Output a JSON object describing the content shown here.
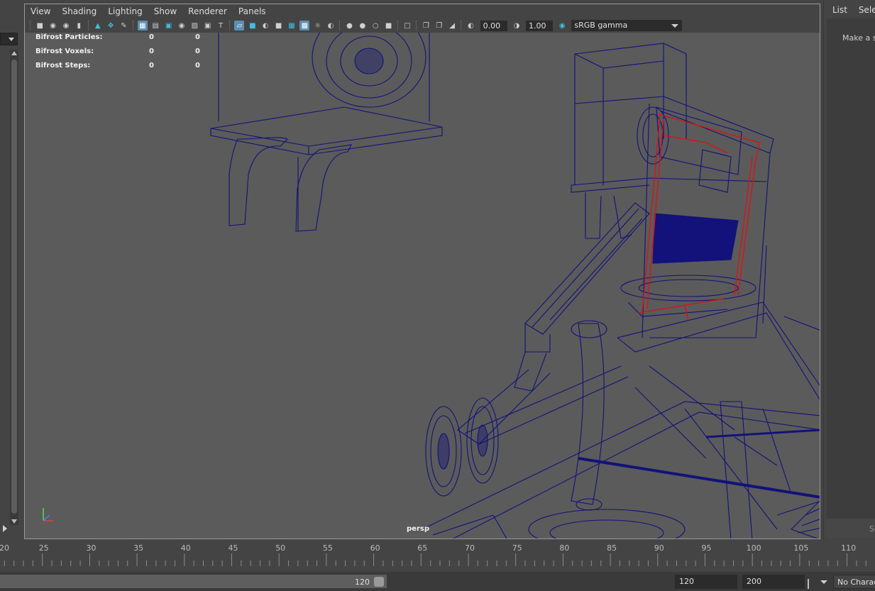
{
  "viewport": {
    "menu": [
      "View",
      "Shading",
      "Lighting",
      "Show",
      "Renderer",
      "Panels"
    ],
    "toolbar": {
      "exposure_value": "0.00",
      "gamma_value": "1.00",
      "color_space": "sRGB gamma",
      "icons": [
        "select-camera-icon",
        "camera-attributes-icon",
        "bookmark-icon",
        "image-plane-icon",
        "grid-icon",
        "film-gate-icon",
        "resolution-gate-icon",
        "wireframe-icon",
        "smooth-shade-icon",
        "textured-icon",
        "lights-icon",
        "shadows-icon",
        "isolate-icon",
        "xray-icon"
      ]
    },
    "hud": [
      {
        "label": "Bifrost Particles:",
        "v1": "0",
        "v2": "0"
      },
      {
        "label": "Bifrost Voxels:",
        "v1": "0",
        "v2": "0"
      },
      {
        "label": "Bifrost Steps:",
        "v1": "0",
        "v2": "0"
      }
    ],
    "camera_label": "persp",
    "wire_color": "#12127a",
    "selected_color": "#e01010"
  },
  "right_panel": {
    "menu": [
      "List",
      "Selected"
    ],
    "hint": "Make a selection",
    "bottom_label": "Select"
  },
  "timeline": {
    "tick_labels": [
      "20",
      "25",
      "30",
      "35",
      "40",
      "45",
      "50",
      "55",
      "60",
      "65",
      "70",
      "75",
      "80",
      "85",
      "90",
      "95",
      "100",
      "105",
      "110"
    ]
  },
  "range": {
    "slider_end": "120",
    "end_time": "120",
    "max_time": "200",
    "character_set": "No Character Set"
  }
}
